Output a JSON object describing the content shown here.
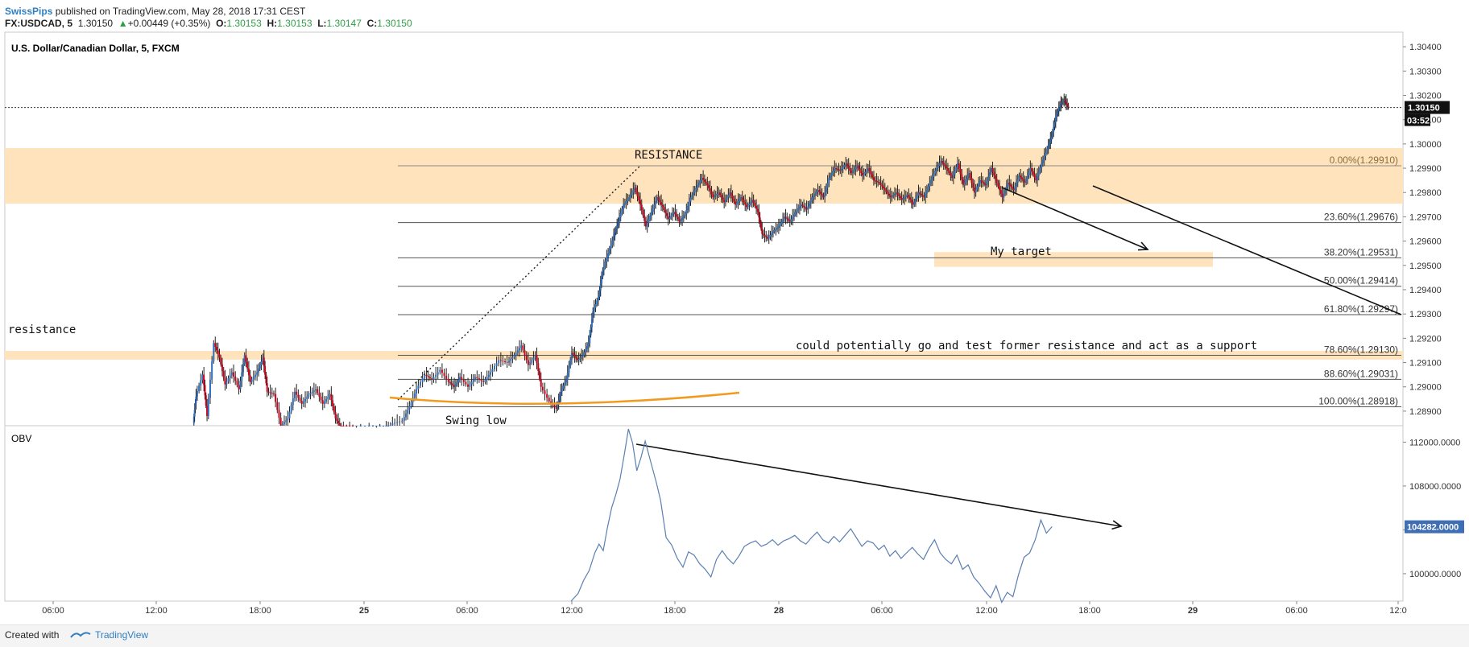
{
  "header": {
    "author": "SwissPips",
    "published_text": "published on TradingView.com, May 28, 2018 17:31 CEST",
    "symbol": "FX:USDCAD, 5",
    "last": "1.30150",
    "change_arrow": "▲",
    "change": "+0.00449 (+0.35%)",
    "o_label": "O:",
    "o_value": "1.30153",
    "h_label": "H:",
    "h_value": "1.30153",
    "l_label": "L:",
    "l_value": "1.30147",
    "c_label": "C:",
    "c_value": "1.30150"
  },
  "footer": {
    "created_with": "Created with",
    "brand": "TradingView"
  },
  "colors": {
    "up": "#2e9e44",
    "down": "#d0021b",
    "candle_blue": "#2f6fbf",
    "zone": "#ffe3bd",
    "obv_line": "#5b7fb0",
    "orange_curve": "#f29a1d",
    "accent": "#2f7fc1"
  },
  "chart_data": [
    {
      "type": "candlestick",
      "title": "U.S. Dollar/Canadian Dollar, 5, FXCM",
      "ylim": [
        1.2884,
        1.3046
      ],
      "y_ticks": [
        "1.30400",
        "1.30300",
        "1.30200",
        "1.30100",
        "1.30000",
        "1.29900",
        "1.29800",
        "1.29700",
        "1.29600",
        "1.29500",
        "1.29400",
        "1.29300",
        "1.29200",
        "1.29100",
        "1.29000",
        "1.28900"
      ],
      "x_ticks": [
        "06:00",
        "12:00",
        "18:00",
        "25",
        "06:00",
        "12:00",
        "18:00",
        "28",
        "06:00",
        "12:00",
        "18:00",
        "29",
        "06:00",
        "12:0"
      ],
      "last_price_label": "1.30150",
      "countdown_label": "03:52",
      "price_path": [
        [
          0.135,
          1.2885
        ],
        [
          0.137,
          1.2896
        ],
        [
          0.142,
          1.2905
        ],
        [
          0.145,
          1.2888
        ],
        [
          0.15,
          1.2918
        ],
        [
          0.154,
          1.2912
        ],
        [
          0.158,
          1.2901
        ],
        [
          0.163,
          1.2906
        ],
        [
          0.168,
          1.2899
        ],
        [
          0.172,
          1.2913
        ],
        [
          0.176,
          1.2902
        ],
        [
          0.181,
          1.2906
        ],
        [
          0.185,
          1.2912
        ],
        [
          0.188,
          1.2898
        ],
        [
          0.193,
          1.2897
        ],
        [
          0.198,
          1.2884
        ],
        [
          0.203,
          1.2887
        ],
        [
          0.208,
          1.2898
        ],
        [
          0.213,
          1.2893
        ],
        [
          0.218,
          1.2897
        ],
        [
          0.223,
          1.2899
        ],
        [
          0.228,
          1.2893
        ],
        [
          0.233,
          1.2897
        ],
        [
          0.237,
          1.2887
        ],
        [
          0.241,
          1.2883
        ],
        [
          0.25,
          1.2882
        ],
        [
          0.262,
          1.2882
        ],
        [
          0.272,
          1.2882
        ],
        [
          0.278,
          1.2885
        ],
        [
          0.285,
          1.2886
        ],
        [
          0.29,
          1.2892
        ],
        [
          0.295,
          1.2899
        ],
        [
          0.301,
          1.2905
        ],
        [
          0.306,
          1.2903
        ],
        [
          0.312,
          1.2907
        ],
        [
          0.318,
          1.2902
        ],
        [
          0.322,
          1.29
        ],
        [
          0.326,
          1.2904
        ],
        [
          0.332,
          1.29
        ],
        [
          0.337,
          1.2904
        ],
        [
          0.343,
          1.2902
        ],
        [
          0.348,
          1.2906
        ],
        [
          0.354,
          1.2911
        ],
        [
          0.36,
          1.291
        ],
        [
          0.365,
          1.2913
        ],
        [
          0.37,
          1.2917
        ],
        [
          0.375,
          1.2909
        ],
        [
          0.38,
          1.2913
        ],
        [
          0.384,
          1.29
        ],
        [
          0.39,
          1.2894
        ],
        [
          0.395,
          1.2891
        ],
        [
          0.398,
          1.2898
        ],
        [
          0.402,
          1.2903
        ],
        [
          0.406,
          1.2914
        ],
        [
          0.41,
          1.2911
        ],
        [
          0.414,
          1.2913
        ],
        [
          0.418,
          1.2918
        ],
        [
          0.421,
          1.2931
        ],
        [
          0.425,
          1.2937
        ],
        [
          0.428,
          1.2948
        ],
        [
          0.432,
          1.2955
        ],
        [
          0.436,
          1.2962
        ],
        [
          0.439,
          1.2968
        ],
        [
          0.443,
          1.2975
        ],
        [
          0.447,
          1.2978
        ],
        [
          0.451,
          1.2982
        ],
        [
          0.455,
          1.2975
        ],
        [
          0.459,
          1.2966
        ],
        [
          0.463,
          1.2972
        ],
        [
          0.467,
          1.2978
        ],
        [
          0.471,
          1.2974
        ],
        [
          0.475,
          1.2969
        ],
        [
          0.479,
          1.2972
        ],
        [
          0.483,
          1.2968
        ],
        [
          0.487,
          1.2971
        ],
        [
          0.491,
          1.2978
        ],
        [
          0.495,
          1.2982
        ],
        [
          0.499,
          1.2986
        ],
        [
          0.503,
          1.2983
        ],
        [
          0.507,
          1.2978
        ],
        [
          0.511,
          1.298
        ],
        [
          0.515,
          1.2976
        ],
        [
          0.519,
          1.298
        ],
        [
          0.523,
          1.2975
        ],
        [
          0.527,
          1.2978
        ],
        [
          0.531,
          1.2974
        ],
        [
          0.535,
          1.2977
        ],
        [
          0.539,
          1.2972
        ],
        [
          0.542,
          1.2963
        ],
        [
          0.546,
          1.2961
        ],
        [
          0.55,
          1.2964
        ],
        [
          0.554,
          1.2966
        ],
        [
          0.558,
          1.297
        ],
        [
          0.562,
          1.2968
        ],
        [
          0.566,
          1.2972
        ],
        [
          0.57,
          1.2975
        ],
        [
          0.574,
          1.2973
        ],
        [
          0.578,
          1.2978
        ],
        [
          0.582,
          1.2981
        ],
        [
          0.586,
          1.2978
        ],
        [
          0.59,
          1.2986
        ],
        [
          0.594,
          1.299
        ],
        [
          0.598,
          1.2989
        ],
        [
          0.602,
          1.2992
        ],
        [
          0.606,
          1.2988
        ],
        [
          0.61,
          1.2991
        ],
        [
          0.614,
          1.2987
        ],
        [
          0.618,
          1.299
        ],
        [
          0.622,
          1.2985
        ],
        [
          0.626,
          1.2984
        ],
        [
          0.63,
          1.2981
        ],
        [
          0.634,
          1.2978
        ],
        [
          0.638,
          1.298
        ],
        [
          0.642,
          1.2977
        ],
        [
          0.646,
          1.2979
        ],
        [
          0.65,
          1.2975
        ],
        [
          0.654,
          1.298
        ],
        [
          0.658,
          1.2978
        ],
        [
          0.662,
          1.2984
        ],
        [
          0.666,
          1.2989
        ],
        [
          0.67,
          1.2993
        ],
        [
          0.674,
          1.299
        ],
        [
          0.678,
          1.2986
        ],
        [
          0.682,
          1.2992
        ],
        [
          0.686,
          1.2983
        ],
        [
          0.69,
          1.2988
        ],
        [
          0.694,
          1.298
        ],
        [
          0.698,
          1.2985
        ],
        [
          0.702,
          1.2983
        ],
        [
          0.706,
          1.299
        ],
        [
          0.71,
          1.2984
        ],
        [
          0.714,
          1.2978
        ],
        [
          0.718,
          1.2984
        ],
        [
          0.722,
          1.2981
        ],
        [
          0.726,
          1.2987
        ],
        [
          0.73,
          1.2984
        ],
        [
          0.734,
          1.299
        ],
        [
          0.738,
          1.2985
        ],
        [
          0.742,
          1.2992
        ],
        [
          0.746,
          1.2998
        ],
        [
          0.749,
          1.3003
        ],
        [
          0.752,
          1.3011
        ],
        [
          0.755,
          1.3016
        ],
        [
          0.758,
          1.3018
        ],
        [
          0.761,
          1.3015
        ]
      ],
      "fibonacci": [
        {
          "label": "0.00%(1.29910)",
          "price": 1.2991
        },
        {
          "label": "23.60%(1.29676)",
          "price": 1.29676
        },
        {
          "label": "38.20%(1.29531)",
          "price": 1.29531
        },
        {
          "label": "50.00%(1.29414)",
          "price": 1.29414
        },
        {
          "label": "61.80%(1.29297)",
          "price": 1.29297
        },
        {
          "label": "78.60%(1.29130)",
          "price": 1.2913
        },
        {
          "label": "88.60%(1.29031)",
          "price": 1.29031
        },
        {
          "label": "100.00%(1.28918)",
          "price": 1.28918
        }
      ],
      "zones": [
        {
          "name": "resistance-zone",
          "from": 1.29754,
          "to": 1.29983
        },
        {
          "name": "former-resistance-zone",
          "from": 1.29112,
          "to": 1.29148
        },
        {
          "name": "target-zone",
          "from": 1.29494,
          "to": 1.29555
        }
      ],
      "annotations": {
        "resistance_upper": "RESISTANCE",
        "resistance_left": "resistance",
        "target": "My target",
        "support_note": "could potentially go and test former resistance and act as a support",
        "swing_low": "Swing low"
      }
    },
    {
      "type": "line",
      "title": "OBV",
      "ylim": [
        97500,
        113500
      ],
      "y_ticks": [
        "112000.0000",
        "108000.0000",
        "104000.0000",
        "100000.0000"
      ],
      "last_value_label": "104282.0000",
      "series": [
        {
          "values": [
            [
              0.405,
              97500
            ],
            [
              0.41,
              98200
            ],
            [
              0.414,
              99400
            ],
            [
              0.418,
              100300
            ],
            [
              0.422,
              101900
            ],
            [
              0.425,
              102700
            ],
            [
              0.428,
              102100
            ],
            [
              0.431,
              104200
            ],
            [
              0.434,
              106000
            ],
            [
              0.437,
              107200
            ],
            [
              0.44,
              108600
            ],
            [
              0.443,
              110800
            ],
            [
              0.446,
              113200
            ],
            [
              0.449,
              111900
            ],
            [
              0.452,
              109400
            ],
            [
              0.455,
              110600
            ],
            [
              0.458,
              112100
            ],
            [
              0.462,
              110200
            ],
            [
              0.466,
              108300
            ],
            [
              0.469,
              106700
            ],
            [
              0.473,
              103300
            ],
            [
              0.477,
              102600
            ],
            [
              0.481,
              101400
            ],
            [
              0.485,
              100600
            ],
            [
              0.489,
              102000
            ],
            [
              0.493,
              101700
            ],
            [
              0.497,
              100900
            ],
            [
              0.501,
              100400
            ],
            [
              0.505,
              99700
            ],
            [
              0.509,
              101300
            ],
            [
              0.513,
              102100
            ],
            [
              0.517,
              101400
            ],
            [
              0.521,
              100900
            ],
            [
              0.525,
              101600
            ],
            [
              0.529,
              102500
            ],
            [
              0.533,
              102800
            ],
            [
              0.537,
              103000
            ],
            [
              0.541,
              102500
            ],
            [
              0.545,
              102700
            ],
            [
              0.549,
              103100
            ],
            [
              0.553,
              102600
            ],
            [
              0.557,
              103000
            ],
            [
              0.561,
              103200
            ],
            [
              0.565,
              103500
            ],
            [
              0.569,
              103000
            ],
            [
              0.573,
              102700
            ],
            [
              0.577,
              103300
            ],
            [
              0.581,
              103800
            ],
            [
              0.585,
              103100
            ],
            [
              0.589,
              102800
            ],
            [
              0.593,
              103400
            ],
            [
              0.597,
              102900
            ],
            [
              0.601,
              103500
            ],
            [
              0.605,
              104100
            ],
            [
              0.609,
              103300
            ],
            [
              0.613,
              102500
            ],
            [
              0.617,
              103000
            ],
            [
              0.621,
              102800
            ],
            [
              0.625,
              102200
            ],
            [
              0.629,
              102600
            ],
            [
              0.633,
              101600
            ],
            [
              0.637,
              102100
            ],
            [
              0.641,
              101400
            ],
            [
              0.645,
              101900
            ],
            [
              0.649,
              102400
            ],
            [
              0.653,
              101800
            ],
            [
              0.657,
              101300
            ],
            [
              0.661,
              102300
            ],
            [
              0.665,
              103100
            ],
            [
              0.669,
              101900
            ],
            [
              0.673,
              101300
            ],
            [
              0.677,
              100900
            ],
            [
              0.681,
              101700
            ],
            [
              0.685,
              100400
            ],
            [
              0.689,
              100800
            ],
            [
              0.693,
              99700
            ],
            [
              0.697,
              99100
            ],
            [
              0.701,
              98400
            ],
            [
              0.705,
              97800
            ],
            [
              0.709,
              98900
            ],
            [
              0.713,
              97400
            ],
            [
              0.717,
              98300
            ],
            [
              0.721,
              97900
            ],
            [
              0.725,
              99900
            ],
            [
              0.729,
              101500
            ],
            [
              0.733,
              101900
            ],
            [
              0.737,
              103100
            ],
            [
              0.741,
              104900
            ],
            [
              0.745,
              103700
            ],
            [
              0.749,
              104300
            ]
          ]
        }
      ]
    }
  ]
}
